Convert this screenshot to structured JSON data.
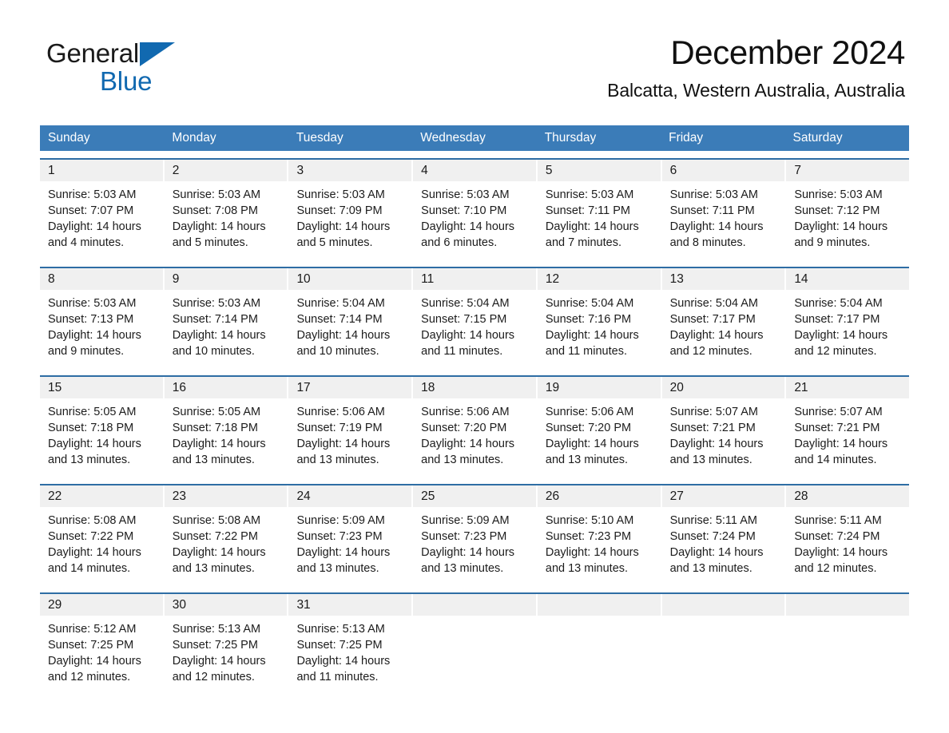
{
  "brand": {
    "word1": "General",
    "word2": "Blue",
    "triangle_color": "#1169b0"
  },
  "header": {
    "month_title": "December 2024",
    "location": "Balcatta, Western Australia, Australia"
  },
  "theme": {
    "header_blue": "#3b7cb8",
    "row_rule_blue": "#2e6da4",
    "day_band_gray": "#f0f0f0"
  },
  "weekdays": [
    "Sunday",
    "Monday",
    "Tuesday",
    "Wednesday",
    "Thursday",
    "Friday",
    "Saturday"
  ],
  "weeks": [
    [
      {
        "day": "1",
        "sunrise": "Sunrise: 5:03 AM",
        "sunset": "Sunset: 7:07 PM",
        "daylight1": "Daylight: 14 hours",
        "daylight2": "and 4 minutes."
      },
      {
        "day": "2",
        "sunrise": "Sunrise: 5:03 AM",
        "sunset": "Sunset: 7:08 PM",
        "daylight1": "Daylight: 14 hours",
        "daylight2": "and 5 minutes."
      },
      {
        "day": "3",
        "sunrise": "Sunrise: 5:03 AM",
        "sunset": "Sunset: 7:09 PM",
        "daylight1": "Daylight: 14 hours",
        "daylight2": "and 5 minutes."
      },
      {
        "day": "4",
        "sunrise": "Sunrise: 5:03 AM",
        "sunset": "Sunset: 7:10 PM",
        "daylight1": "Daylight: 14 hours",
        "daylight2": "and 6 minutes."
      },
      {
        "day": "5",
        "sunrise": "Sunrise: 5:03 AM",
        "sunset": "Sunset: 7:11 PM",
        "daylight1": "Daylight: 14 hours",
        "daylight2": "and 7 minutes."
      },
      {
        "day": "6",
        "sunrise": "Sunrise: 5:03 AM",
        "sunset": "Sunset: 7:11 PM",
        "daylight1": "Daylight: 14 hours",
        "daylight2": "and 8 minutes."
      },
      {
        "day": "7",
        "sunrise": "Sunrise: 5:03 AM",
        "sunset": "Sunset: 7:12 PM",
        "daylight1": "Daylight: 14 hours",
        "daylight2": "and 9 minutes."
      }
    ],
    [
      {
        "day": "8",
        "sunrise": "Sunrise: 5:03 AM",
        "sunset": "Sunset: 7:13 PM",
        "daylight1": "Daylight: 14 hours",
        "daylight2": "and 9 minutes."
      },
      {
        "day": "9",
        "sunrise": "Sunrise: 5:03 AM",
        "sunset": "Sunset: 7:14 PM",
        "daylight1": "Daylight: 14 hours",
        "daylight2": "and 10 minutes."
      },
      {
        "day": "10",
        "sunrise": "Sunrise: 5:04 AM",
        "sunset": "Sunset: 7:14 PM",
        "daylight1": "Daylight: 14 hours",
        "daylight2": "and 10 minutes."
      },
      {
        "day": "11",
        "sunrise": "Sunrise: 5:04 AM",
        "sunset": "Sunset: 7:15 PM",
        "daylight1": "Daylight: 14 hours",
        "daylight2": "and 11 minutes."
      },
      {
        "day": "12",
        "sunrise": "Sunrise: 5:04 AM",
        "sunset": "Sunset: 7:16 PM",
        "daylight1": "Daylight: 14 hours",
        "daylight2": "and 11 minutes."
      },
      {
        "day": "13",
        "sunrise": "Sunrise: 5:04 AM",
        "sunset": "Sunset: 7:17 PM",
        "daylight1": "Daylight: 14 hours",
        "daylight2": "and 12 minutes."
      },
      {
        "day": "14",
        "sunrise": "Sunrise: 5:04 AM",
        "sunset": "Sunset: 7:17 PM",
        "daylight1": "Daylight: 14 hours",
        "daylight2": "and 12 minutes."
      }
    ],
    [
      {
        "day": "15",
        "sunrise": "Sunrise: 5:05 AM",
        "sunset": "Sunset: 7:18 PM",
        "daylight1": "Daylight: 14 hours",
        "daylight2": "and 13 minutes."
      },
      {
        "day": "16",
        "sunrise": "Sunrise: 5:05 AM",
        "sunset": "Sunset: 7:18 PM",
        "daylight1": "Daylight: 14 hours",
        "daylight2": "and 13 minutes."
      },
      {
        "day": "17",
        "sunrise": "Sunrise: 5:06 AM",
        "sunset": "Sunset: 7:19 PM",
        "daylight1": "Daylight: 14 hours",
        "daylight2": "and 13 minutes."
      },
      {
        "day": "18",
        "sunrise": "Sunrise: 5:06 AM",
        "sunset": "Sunset: 7:20 PM",
        "daylight1": "Daylight: 14 hours",
        "daylight2": "and 13 minutes."
      },
      {
        "day": "19",
        "sunrise": "Sunrise: 5:06 AM",
        "sunset": "Sunset: 7:20 PM",
        "daylight1": "Daylight: 14 hours",
        "daylight2": "and 13 minutes."
      },
      {
        "day": "20",
        "sunrise": "Sunrise: 5:07 AM",
        "sunset": "Sunset: 7:21 PM",
        "daylight1": "Daylight: 14 hours",
        "daylight2": "and 13 minutes."
      },
      {
        "day": "21",
        "sunrise": "Sunrise: 5:07 AM",
        "sunset": "Sunset: 7:21 PM",
        "daylight1": "Daylight: 14 hours",
        "daylight2": "and 14 minutes."
      }
    ],
    [
      {
        "day": "22",
        "sunrise": "Sunrise: 5:08 AM",
        "sunset": "Sunset: 7:22 PM",
        "daylight1": "Daylight: 14 hours",
        "daylight2": "and 14 minutes."
      },
      {
        "day": "23",
        "sunrise": "Sunrise: 5:08 AM",
        "sunset": "Sunset: 7:22 PM",
        "daylight1": "Daylight: 14 hours",
        "daylight2": "and 13 minutes."
      },
      {
        "day": "24",
        "sunrise": "Sunrise: 5:09 AM",
        "sunset": "Sunset: 7:23 PM",
        "daylight1": "Daylight: 14 hours",
        "daylight2": "and 13 minutes."
      },
      {
        "day": "25",
        "sunrise": "Sunrise: 5:09 AM",
        "sunset": "Sunset: 7:23 PM",
        "daylight1": "Daylight: 14 hours",
        "daylight2": "and 13 minutes."
      },
      {
        "day": "26",
        "sunrise": "Sunrise: 5:10 AM",
        "sunset": "Sunset: 7:23 PM",
        "daylight1": "Daylight: 14 hours",
        "daylight2": "and 13 minutes."
      },
      {
        "day": "27",
        "sunrise": "Sunrise: 5:11 AM",
        "sunset": "Sunset: 7:24 PM",
        "daylight1": "Daylight: 14 hours",
        "daylight2": "and 13 minutes."
      },
      {
        "day": "28",
        "sunrise": "Sunrise: 5:11 AM",
        "sunset": "Sunset: 7:24 PM",
        "daylight1": "Daylight: 14 hours",
        "daylight2": "and 12 minutes."
      }
    ],
    [
      {
        "day": "29",
        "sunrise": "Sunrise: 5:12 AM",
        "sunset": "Sunset: 7:25 PM",
        "daylight1": "Daylight: 14 hours",
        "daylight2": "and 12 minutes."
      },
      {
        "day": "30",
        "sunrise": "Sunrise: 5:13 AM",
        "sunset": "Sunset: 7:25 PM",
        "daylight1": "Daylight: 14 hours",
        "daylight2": "and 12 minutes."
      },
      {
        "day": "31",
        "sunrise": "Sunrise: 5:13 AM",
        "sunset": "Sunset: 7:25 PM",
        "daylight1": "Daylight: 14 hours",
        "daylight2": "and 11 minutes."
      },
      {
        "day": "",
        "sunrise": "",
        "sunset": "",
        "daylight1": "",
        "daylight2": ""
      },
      {
        "day": "",
        "sunrise": "",
        "sunset": "",
        "daylight1": "",
        "daylight2": ""
      },
      {
        "day": "",
        "sunrise": "",
        "sunset": "",
        "daylight1": "",
        "daylight2": ""
      },
      {
        "day": "",
        "sunrise": "",
        "sunset": "",
        "daylight1": "",
        "daylight2": ""
      }
    ]
  ]
}
